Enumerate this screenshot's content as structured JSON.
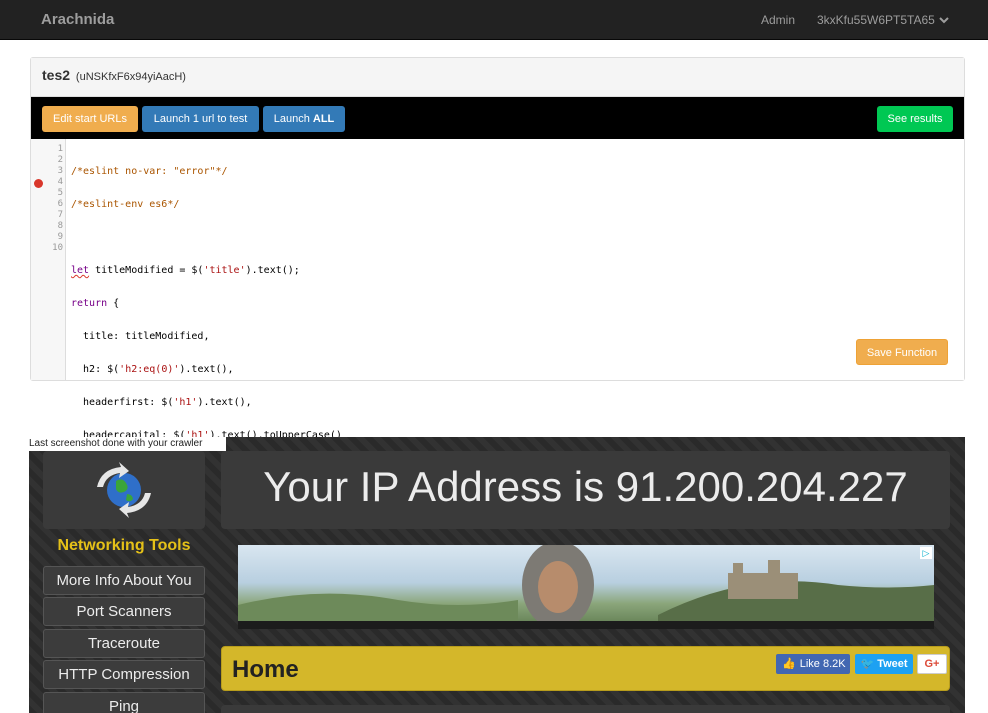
{
  "navbar": {
    "brand": "Arachnida",
    "admin": "Admin",
    "user": "3kxKfu55W6PT5TA65"
  },
  "panel": {
    "title": "tes2",
    "id": "(uNSKfxF6x94yiAacH)"
  },
  "toolbar": {
    "edit_label": "Edit start URLs",
    "launch_one_label": "Launch 1 url to test",
    "launch_all_prefix": "Launch ",
    "launch_all_strong": "ALL",
    "results_label": "See results"
  },
  "editor": {
    "line_numbers": [
      "1",
      "2",
      "3",
      "4",
      "5",
      "6",
      "7",
      "8",
      "9",
      "10"
    ],
    "lines": [
      "/*eslint no-var: \"error\"*/",
      "/*eslint-env es6*/",
      "",
      "let titleModified = $('title').text();",
      "return {",
      "  title: titleModified,",
      "  h2: $('h2:eq(0)').text(),",
      "  headerfirst: $('h1').text(),",
      "  headercapital: $('h1').text().toUpperCase()",
      "};"
    ],
    "save_label": "Save Function"
  },
  "screenshot": {
    "label": "Last screenshot done with your crawler",
    "ip_text": "Your IP Address is 91.200.204.227",
    "networking_tools": "Networking Tools",
    "side_menu": [
      "More Info About You",
      "Port Scanners",
      "Traceroute",
      "HTTP Compression",
      "Ping"
    ],
    "home_title": "Home",
    "fb_like": "Like",
    "fb_count": "8.2K",
    "tweet": "Tweet",
    "gplus": "G+"
  },
  "colors": {
    "navbar_bg": "#222222",
    "warning": "#f0ad4e",
    "primary": "#337ab7",
    "success": "#00c853",
    "accent_yellow": "#d4b72a"
  }
}
